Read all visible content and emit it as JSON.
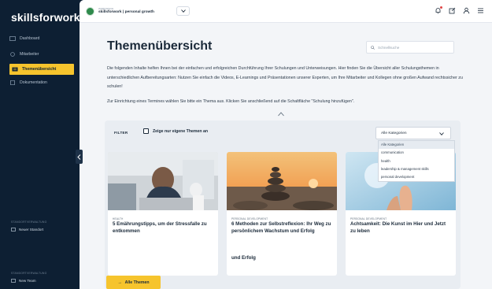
{
  "app": {
    "logo": "skillsforwork"
  },
  "sidebar": {
    "items": [
      {
        "label": "Dashboard",
        "icon": "dashboard-icon"
      },
      {
        "label": "Mitarbeiter",
        "icon": "user-icon"
      },
      {
        "label": "Themenübersicht",
        "icon": "book-icon",
        "active": true
      },
      {
        "label": "Dokumentation",
        "icon": "document-icon"
      }
    ],
    "section1": {
      "label": "STANDORTVERWALTUNG",
      "link": "Neuer Standort"
    },
    "section2": {
      "label": "STANDORTVERWALTUNG",
      "link": "New Team"
    }
  },
  "topbar": {
    "org_small": "WORKSPACE",
    "org_name": "skillsforwork | personal growth",
    "icons": [
      "bell-icon",
      "edit-icon",
      "user-icon",
      "menu-icon"
    ]
  },
  "page": {
    "title": "Themenübersicht",
    "search_placeholder": "Schnellsuche",
    "intro": "Die folgenden Inhalte helfen Ihnen bei der einfachen und erfolgreichen Durchführung Ihrer Schulungen und Unterweisungen. Hier finden Sie die Übersicht aller Schulungsthemen in unterschiedlichen Aufbereitungsarten: Nutzen Sie einfach die Videos, E-Learnings und Präsentationen unserer Experten, um Ihre Mitarbeiter und Kollegen ohne großen Aufwand rechtssicher zu schulen!",
    "intro2": "Zur Einrichtung eines Termines wählen Sie bitte ein Thema aus. Klicken Sie anschließend auf die Schaltfläche \"Schulung hinzufügen\"."
  },
  "filter": {
    "label": "FILTER",
    "own_only": "Zeige nur eigene Themen an",
    "selected": "Alle Kategorien",
    "options": [
      "Alle Kategorien",
      "communication",
      "health",
      "leadership & management skills",
      "personal development"
    ]
  },
  "cards": [
    {
      "category": "HEALTH",
      "title": "5 Emährungstipps, um der Stressfalle zu entkommen",
      "title2": ""
    },
    {
      "category": "PERSONAL DEVELOPMENT",
      "title": "6 Methoden zur Selbstreflexion: Ihr Weg zu persönlichem Wachstum und Erfolg",
      "title2": "und Erfolg"
    },
    {
      "category": "PERSONAL DEVELOPMENT",
      "title": "Achtsamkeit: Die Kunst im Hier und Jetzt zu leben",
      "title2": ""
    }
  ],
  "buttons": {
    "all_topics": "Alle Themen"
  },
  "colors": {
    "sidebar_bg": "#0d1f33",
    "accent": "#f6c42d",
    "main_bg": "#f3f5f8"
  }
}
